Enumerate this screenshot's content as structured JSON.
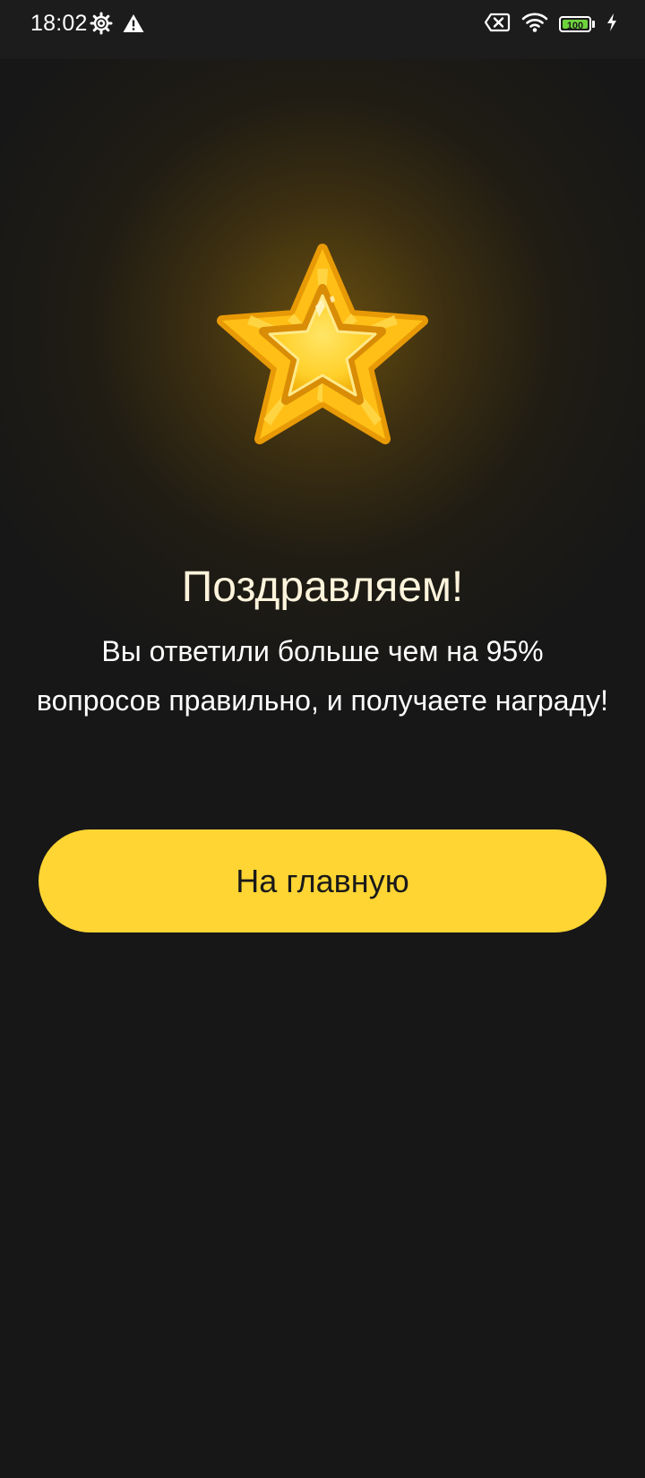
{
  "status_bar": {
    "time": "18:02",
    "battery_level": "100",
    "icons": [
      "settings-gear-icon",
      "warning-icon",
      "no-sim-icon",
      "wifi-icon",
      "battery-icon",
      "charging-bolt-icon"
    ]
  },
  "reward": {
    "icon": "gold-star-icon",
    "title": "Поздравляем!",
    "message": "Вы ответили больше чем на 95% вопросов правильно, и получаете награду!"
  },
  "actions": {
    "home_label": "На главную"
  },
  "colors": {
    "background": "#171717",
    "accent": "#ffd533",
    "title_text": "#fff4dc",
    "star_gold": "#ffc21a",
    "battery_green": "#6dd23c"
  }
}
